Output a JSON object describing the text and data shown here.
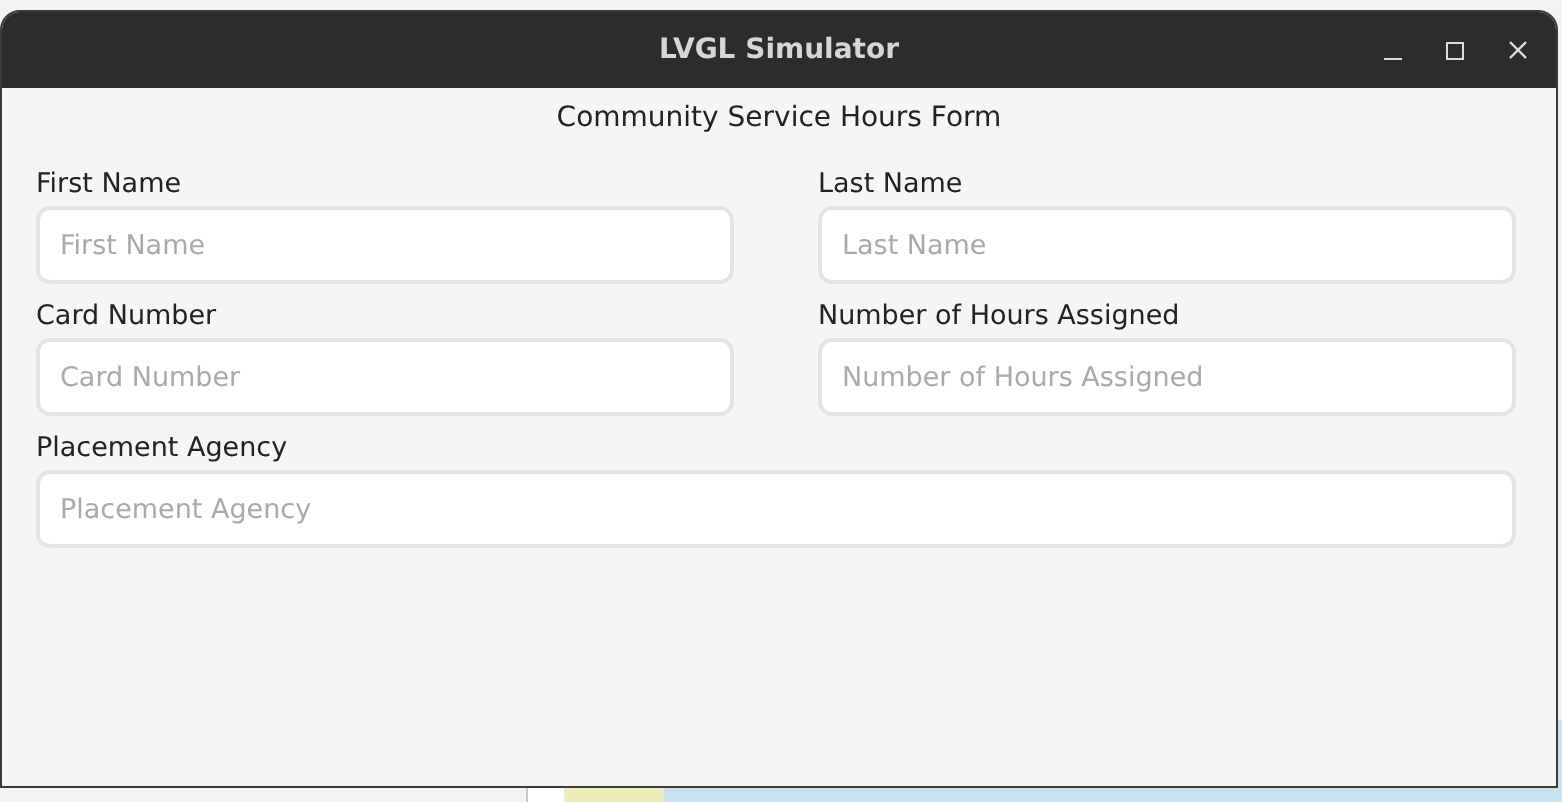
{
  "window": {
    "title": "LVGL Simulator"
  },
  "form": {
    "title": "Community Service Hours Form",
    "fields": [
      {
        "label": "First Name",
        "placeholder": "First Name",
        "kind": "half"
      },
      {
        "label": "Last Name",
        "placeholder": "Last Name",
        "kind": "half"
      },
      {
        "label": "Card Number",
        "placeholder": "Card Number",
        "kind": "half"
      },
      {
        "label": "Number of Hours Assigned",
        "placeholder": "Number of Hours Assigned",
        "kind": "half"
      },
      {
        "label": "Placement Agency",
        "placeholder": "Placement Agency",
        "kind": "full"
      }
    ]
  }
}
